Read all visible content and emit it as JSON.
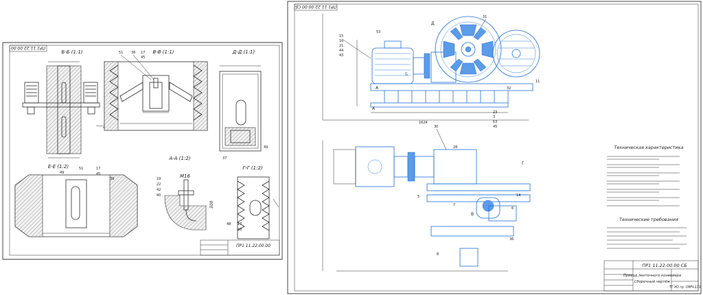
{
  "left_sheet": {
    "stamp_top": "ПР1 11.22.00.00",
    "title_block_code": "ПР1 11.22.00.00",
    "views": [
      {
        "id": "bb",
        "label": "Б-Б (1:1)"
      },
      {
        "id": "vv",
        "label": "В-В (1:1)"
      },
      {
        "id": "dd",
        "label": "Д-Д (1:1)"
      },
      {
        "id": "ee",
        "label": "Е-Е (1:2)"
      },
      {
        "id": "aa",
        "label": "А-А (1:2)"
      },
      {
        "id": "gg",
        "label": "Г-Г (1:2)"
      }
    ],
    "labels": {
      "thread": "М16",
      "dim_300": "300",
      "p25a": "25",
      "p35": "35",
      "p26": "26",
      "p51": "51",
      "p38": "38",
      "p17": "17",
      "p45": "45",
      "p37": "37",
      "p49a": "49",
      "p25b": "25",
      "p49b": "49",
      "p51b": "51",
      "p17b": "17",
      "p45b": "45",
      "p39": "39",
      "p19": "19",
      "p22": "22",
      "p42": "42",
      "p40": "40",
      "p48": "48",
      "p17c": "17",
      "p45c": "45"
    }
  },
  "right_sheet": {
    "stamp_top": "ПР1 11.22.00.00 СБ",
    "tech_char_title": "Техническая характеристика",
    "tech_req_title": "Технические требования",
    "title_block": {
      "code": "ПР1 11.22.00.00 СБ",
      "name_line1": "Привод ленточного конвейера",
      "name_line2": "Сборочный чертёж",
      "group": "ТГ УО гр. ОМЧ-171"
    },
    "labels": {
      "p53": "53",
      "p15": "15",
      "p16": "16",
      "p21": "21",
      "p44": "44",
      "p43": "43",
      "p20": "20",
      "p31": "31",
      "p32": "32",
      "p11": "11",
      "p30": "30",
      "p28": "28",
      "p5": "5",
      "p7": "7",
      "p8": "8",
      "p6": "6",
      "p14": "14",
      "p36": "36",
      "p23": "23",
      "p3": "3",
      "p63": "63",
      "p45": "45",
      "A": "А",
      "B": "Б",
      "V": "В",
      "G": "Г",
      "D": "Д",
      "E": "Е",
      "dim_1624": "1624"
    }
  }
}
